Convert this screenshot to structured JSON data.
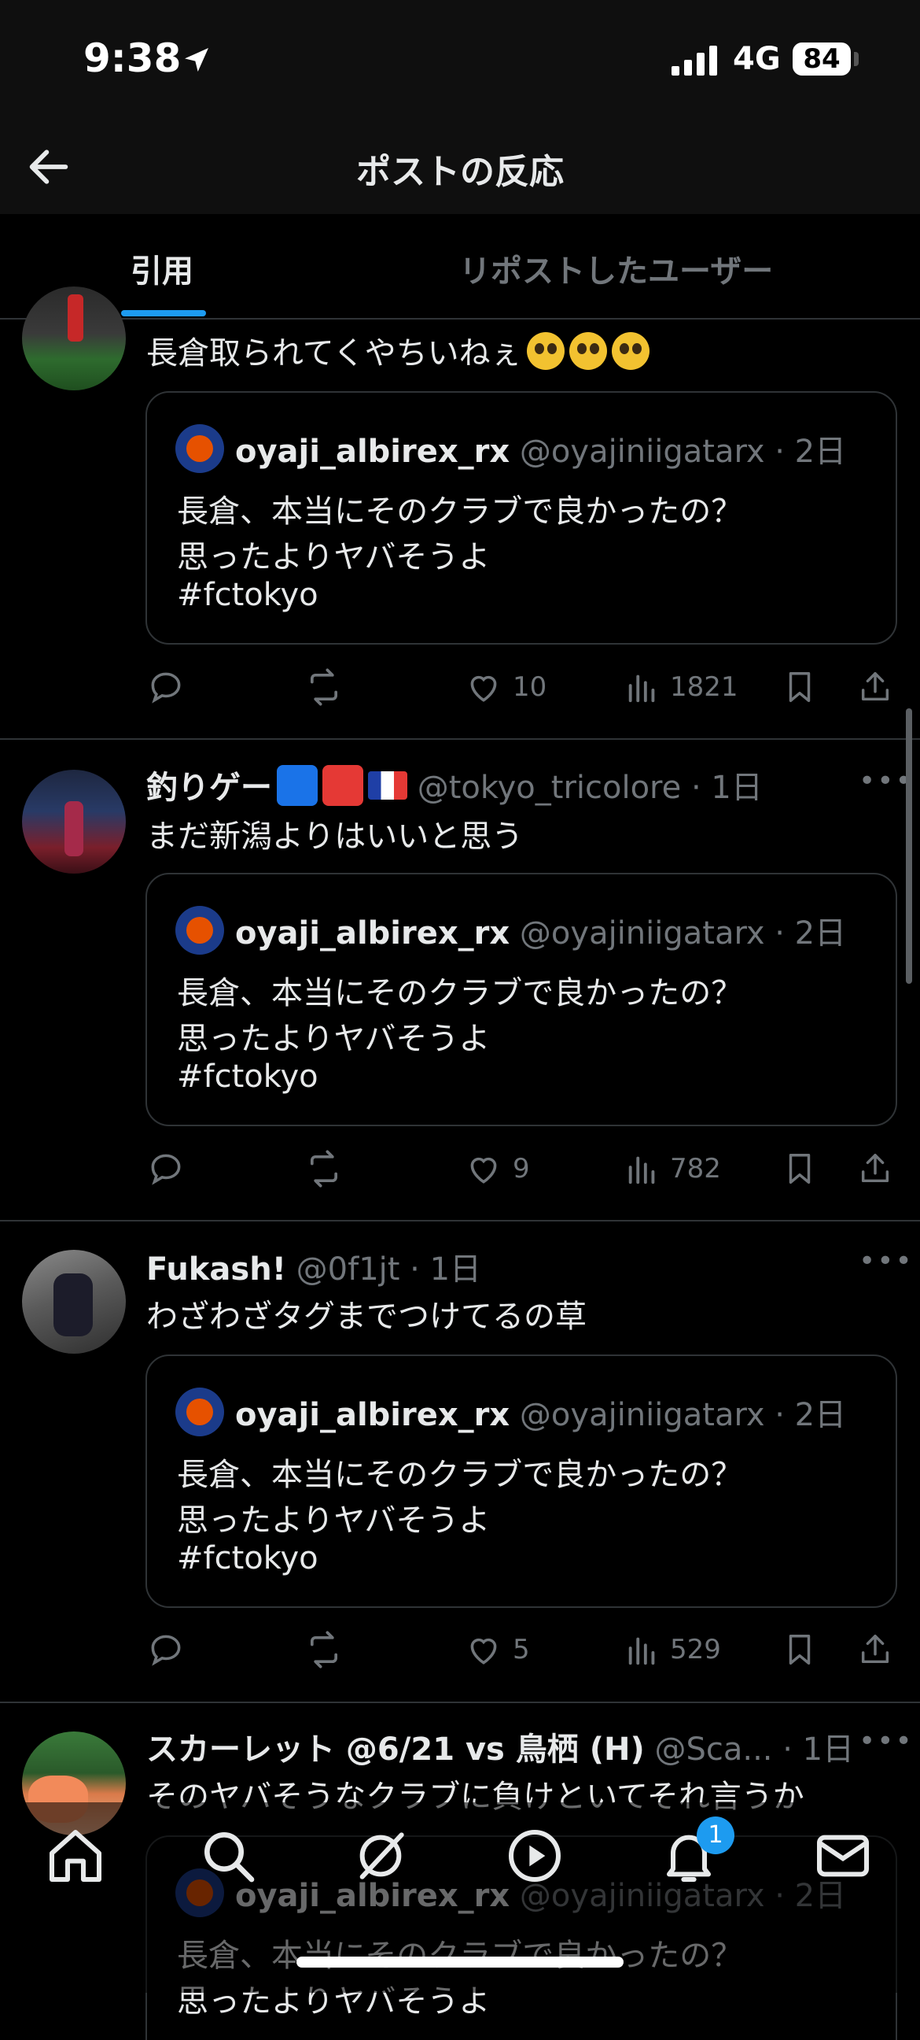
{
  "status_bar": {
    "time": "9:38",
    "network": "4G",
    "battery": "84"
  },
  "header": {
    "title": "ポストの反応"
  },
  "tabs": [
    {
      "label": "引用",
      "active": true
    },
    {
      "label": "リポストしたユーザー",
      "active": false
    }
  ],
  "quoted": {
    "name": "oyaji_albirex_rx",
    "handle": "@oyajiniigatarx · 2日",
    "lines": [
      "長倉、本当にそのクラブで良かったの？",
      "思ったよりヤバそうよ",
      "#fctokyo"
    ]
  },
  "posts": [
    {
      "text": "長倉取られてくやちいねぇ",
      "likes": "10",
      "views": "1821"
    },
    {
      "name": "釣りゲー",
      "handle": "@tokyo_tricolore · 1日",
      "text": "まだ新潟よりはいいと思う",
      "likes": "9",
      "views": "782"
    },
    {
      "name": "Fukash!",
      "handle": "@0f1jt · 1日",
      "text": "わざわざタグまでつけてるの草",
      "likes": "5",
      "views": "529"
    },
    {
      "name": "スカーレット @6/21 vs 鳥栖 (H)",
      "handle": "@Sca... · 1日",
      "text": "そのヤバそうなクラブに負けといてそれ言うか"
    }
  ],
  "bottom_nav": {
    "notifications_badge": "1"
  },
  "colors": {
    "accent": "#1d9bf0",
    "background": "#000000",
    "muted": "#71767b",
    "border": "#2f3336"
  },
  "icons": [
    "back-arrow-icon",
    "location-arrow-icon",
    "signal-icon",
    "reply-icon",
    "repost-icon",
    "like-icon",
    "views-icon",
    "bookmark-icon",
    "share-icon",
    "more-icon",
    "home-icon",
    "search-icon",
    "grok-icon",
    "video-icon",
    "bell-icon",
    "mail-icon"
  ]
}
